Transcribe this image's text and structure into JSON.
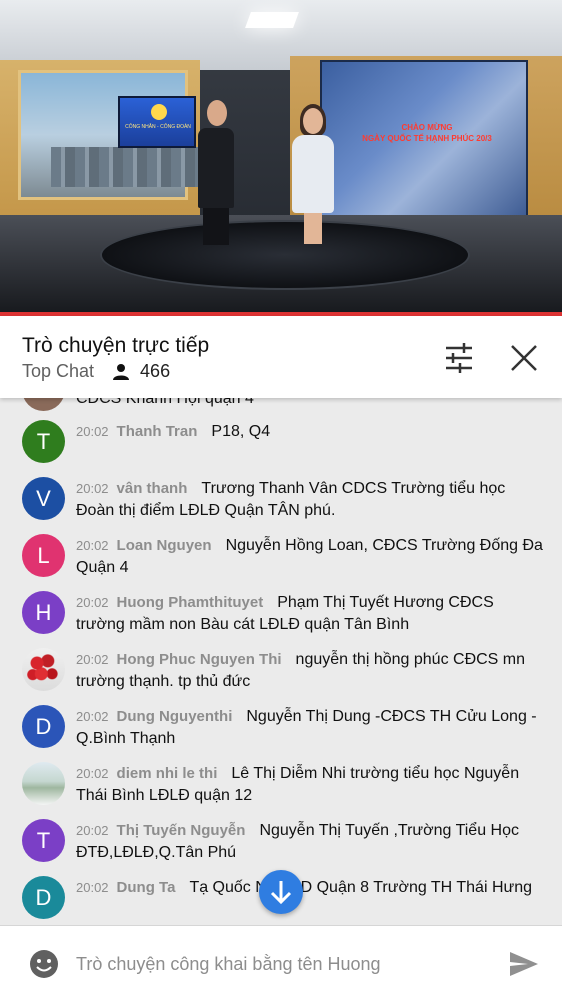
{
  "video": {
    "wall_title_line1": "CHÀO MỪNG",
    "wall_title_line2": "NGÀY QUỐC TẾ HẠNH PHÚC 20/3",
    "screen_text": "CÔNG NHÂN - CÔNG ĐOÀN"
  },
  "chat": {
    "title": "Trò chuyện trực tiếp",
    "mode": "Top Chat",
    "viewer_count": "466",
    "partial_message": "CĐCS Khánh Hội quận 4",
    "messages": [
      {
        "initial": "T",
        "color": "#2f7d1e",
        "time": "20:02",
        "author": "Thanh Tran",
        "text": "P18, Q4"
      },
      {
        "initial": "V",
        "color": "#1c4fa3",
        "time": "20:02",
        "author": "vân thanh",
        "text": "Trương Thanh Vân CDCS Trường tiểu học Đoàn thị điểm LĐLĐ Quận TÂN phú."
      },
      {
        "initial": "L",
        "color": "#e03370",
        "time": "20:02",
        "author": "Loan Nguyen",
        "text": "Nguyễn Hồng Loan, CĐCS Trường Đống Đa Quận 4"
      },
      {
        "initial": "H",
        "color": "#7b3fc6",
        "time": "20:02",
        "author": "Huong Phamthituyet",
        "text": "Phạm Thị Tuyết Hương CĐCS trường mầm non Bàu cát LĐLĐ quận Tân Bình"
      },
      {
        "initial": "",
        "color": "#c0c0c0",
        "time": "20:02",
        "author": "Hong Phuc Nguyen Thi",
        "text": "nguyễn thị hồng phúc CĐCS mn trường thạnh. tp thủ đức",
        "avatar_image": "roses-photo"
      },
      {
        "initial": "D",
        "color": "#2b55b8",
        "time": "20:02",
        "author": "Dung Nguyenthi",
        "text": "Nguyễn Thị Dung -CĐCS TH Cửu Long -Q.Bình Thạnh"
      },
      {
        "initial": "",
        "color": "#c0c0c0",
        "time": "20:02",
        "author": "diem nhi le thi",
        "text": "Lê Thị Diễm Nhi trường tiểu học Nguyễn Thái Bình LĐLĐ quận 12",
        "avatar_image": "landscape-photo"
      },
      {
        "initial": "T",
        "color": "#7b3fc6",
        "time": "20:02",
        "author": "Thị Tuyến Nguyễn",
        "text": "Nguyễn Thị Tuyến ,Trường Tiểu Học ĐTĐ,LĐLĐ,Q.Tân Phú"
      },
      {
        "initial": "D",
        "color": "#1a8a9a",
        "time": "20:02",
        "author": "Dung Ta",
        "text": "Tạ Quốc N LĐLD Quận 8 Trường TH Thái Hưng"
      }
    ]
  },
  "input": {
    "placeholder": "Trò chuyện công khai bằng tên Huong"
  },
  "colors": {
    "accent": "#2f7de1",
    "progress": "#dd3333",
    "chat_bg": "#ebebeb"
  },
  "icons": {
    "viewer": "person-icon",
    "settings": "sliders-icon",
    "close": "close-icon",
    "scroll": "arrow-down-icon",
    "emoji": "emoji-icon",
    "send": "send-icon"
  }
}
